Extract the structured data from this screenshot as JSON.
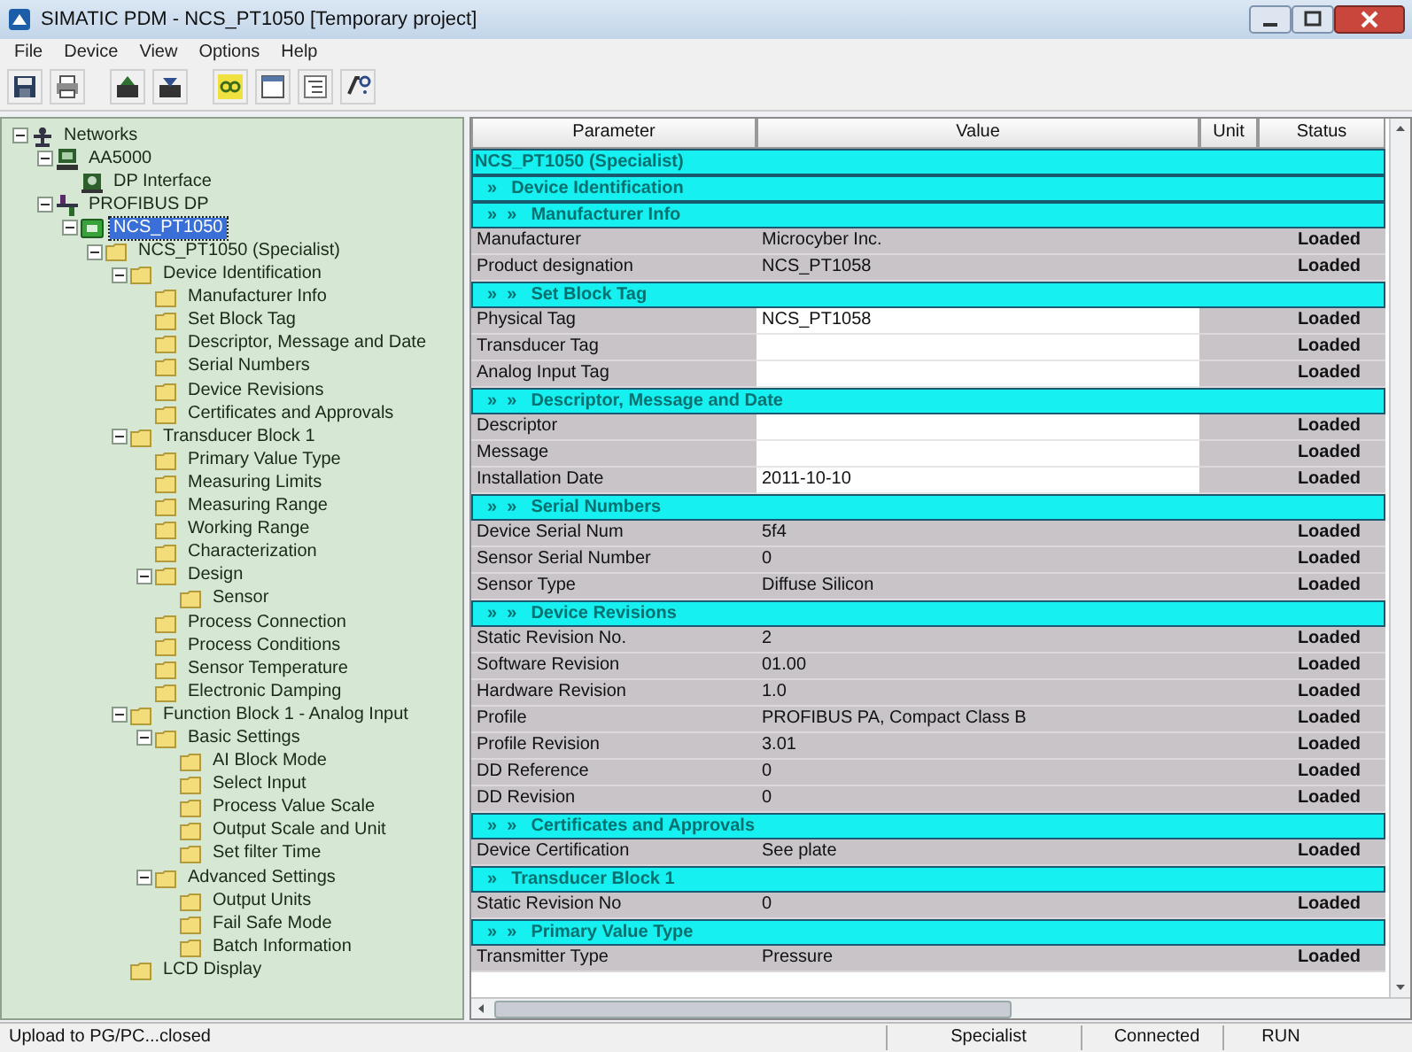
{
  "window": {
    "title": "SIMATIC PDM - NCS_PT1050 [Temporary project]"
  },
  "menu": [
    "File",
    "Device",
    "View",
    "Options",
    "Help"
  ],
  "toolbar": [
    {
      "kind": "save"
    },
    {
      "kind": "print"
    },
    {
      "kind": "upload"
    },
    {
      "kind": "download"
    },
    {
      "kind": "online"
    },
    {
      "kind": "window"
    },
    {
      "kind": "tree"
    },
    {
      "kind": "help"
    }
  ],
  "tree": [
    {
      "label": "Networks",
      "kind": "networks",
      "selected": false,
      "expanded": true,
      "children": [
        {
          "label": "AA5000",
          "kind": "computer",
          "selected": false,
          "expanded": true,
          "children": [
            {
              "label": "DP Interface",
              "kind": "interface",
              "selected": false
            }
          ]
        },
        {
          "label": "PROFIBUS DP",
          "kind": "bus",
          "selected": false,
          "expanded": true,
          "children": [
            {
              "label": "NCS_PT1050",
              "kind": "device",
              "selected": true,
              "expanded": true,
              "children": [
                {
                  "label": "NCS_PT1050 (Specialist)",
                  "kind": "folder",
                  "selected": false,
                  "expanded": true,
                  "children": [
                    {
                      "label": "Device Identification",
                      "kind": "folder",
                      "selected": false,
                      "expanded": true,
                      "children": [
                        {
                          "label": "Manufacturer Info",
                          "kind": "folder",
                          "selected": false
                        },
                        {
                          "label": "Set Block Tag",
                          "kind": "folder",
                          "selected": false
                        },
                        {
                          "label": "Descriptor, Message and Date",
                          "kind": "folder",
                          "selected": false
                        },
                        {
                          "label": "Serial Numbers",
                          "kind": "folder",
                          "selected": false
                        },
                        {
                          "label": "Device Revisions",
                          "kind": "folder",
                          "selected": false
                        },
                        {
                          "label": "Certificates and Approvals",
                          "kind": "folder",
                          "selected": false
                        }
                      ]
                    },
                    {
                      "label": "Transducer Block 1",
                      "kind": "folder",
                      "selected": false,
                      "expanded": true,
                      "children": [
                        {
                          "label": "Primary Value Type",
                          "kind": "folder",
                          "selected": false
                        },
                        {
                          "label": "Measuring Limits",
                          "kind": "folder",
                          "selected": false
                        },
                        {
                          "label": "Measuring Range",
                          "kind": "folder",
                          "selected": false
                        },
                        {
                          "label": "Working Range",
                          "kind": "folder",
                          "selected": false
                        },
                        {
                          "label": "Characterization",
                          "kind": "folder",
                          "selected": false
                        },
                        {
                          "label": "Design",
                          "kind": "folder",
                          "selected": false,
                          "expanded": true,
                          "children": [
                            {
                              "label": "Sensor",
                              "kind": "folder",
                              "selected": false
                            }
                          ]
                        },
                        {
                          "label": "Process Connection",
                          "kind": "folder",
                          "selected": false
                        },
                        {
                          "label": "Process Conditions",
                          "kind": "folder",
                          "selected": false
                        },
                        {
                          "label": "Sensor Temperature",
                          "kind": "folder",
                          "selected": false
                        },
                        {
                          "label": "Electronic Damping",
                          "kind": "folder",
                          "selected": false
                        }
                      ]
                    },
                    {
                      "label": "Function Block 1 - Analog Input",
                      "kind": "folder",
                      "selected": false,
                      "expanded": true,
                      "children": [
                        {
                          "label": "Basic Settings",
                          "kind": "folder",
                          "selected": false,
                          "expanded": true,
                          "children": [
                            {
                              "label": "AI Block Mode",
                              "kind": "folder",
                              "selected": false
                            },
                            {
                              "label": "Select Input",
                              "kind": "folder",
                              "selected": false
                            },
                            {
                              "label": "Process Value Scale",
                              "kind": "folder",
                              "selected": false
                            },
                            {
                              "label": "Output Scale and Unit",
                              "kind": "folder",
                              "selected": false
                            },
                            {
                              "label": "Set filter Time",
                              "kind": "folder",
                              "selected": false
                            }
                          ]
                        },
                        {
                          "label": "Advanced Settings",
                          "kind": "folder",
                          "selected": false,
                          "expanded": true,
                          "children": [
                            {
                              "label": "Output Units",
                              "kind": "folder",
                              "selected": false
                            },
                            {
                              "label": "Fail Safe Mode",
                              "kind": "folder",
                              "selected": false
                            },
                            {
                              "label": "Batch Information",
                              "kind": "folder",
                              "selected": false
                            }
                          ]
                        }
                      ]
                    },
                    {
                      "label": "LCD Display",
                      "kind": "folder",
                      "selected": false
                    }
                  ]
                }
              ]
            }
          ]
        }
      ]
    }
  ],
  "table": {
    "columns": [
      "Parameter",
      "Value",
      "Unit",
      "Status"
    ],
    "rows": [
      {
        "kind": "section",
        "label": "NCS_PT1050 (Specialist)"
      },
      {
        "kind": "section",
        "marker": "»",
        "label": "Device Identification"
      },
      {
        "kind": "section",
        "marker": "»  »",
        "label": "Manufacturer Info"
      },
      {
        "kind": "param",
        "parameter": "Manufacturer",
        "value": "Microcyber Inc.",
        "editable": false,
        "status": "Loaded"
      },
      {
        "kind": "param",
        "parameter": "Product designation",
        "value": "NCS_PT1058",
        "editable": false,
        "status": "Loaded"
      },
      {
        "kind": "section",
        "marker": "»  »",
        "label": "Set Block Tag"
      },
      {
        "kind": "param",
        "parameter": "Physical Tag",
        "value": "NCS_PT1058",
        "editable": true,
        "status": "Loaded"
      },
      {
        "kind": "param",
        "parameter": "Transducer Tag",
        "editable": true,
        "status": "Loaded"
      },
      {
        "kind": "param",
        "parameter": "Analog Input Tag",
        "editable": true,
        "status": "Loaded"
      },
      {
        "kind": "section",
        "marker": "»  »",
        "label": "Descriptor, Message and Date"
      },
      {
        "kind": "param",
        "parameter": "Descriptor",
        "editable": true,
        "status": "Loaded"
      },
      {
        "kind": "param",
        "parameter": "Message",
        "editable": true,
        "status": "Loaded"
      },
      {
        "kind": "param",
        "parameter": "Installation Date",
        "value": "2011-10-10",
        "editable": true,
        "status": "Loaded"
      },
      {
        "kind": "section",
        "marker": "»  »",
        "label": "Serial Numbers"
      },
      {
        "kind": "param",
        "parameter": "Device Serial Num",
        "value": "5f4",
        "editable": false,
        "status": "Loaded"
      },
      {
        "kind": "param",
        "parameter": "Sensor Serial Number",
        "value": "0",
        "editable": false,
        "status": "Loaded"
      },
      {
        "kind": "param",
        "parameter": "Sensor Type",
        "value": "Diffuse Silicon",
        "editable": false,
        "status": "Loaded"
      },
      {
        "kind": "section",
        "marker": "»  »",
        "label": "Device Revisions"
      },
      {
        "kind": "param",
        "parameter": "Static Revision No.",
        "value": "2",
        "editable": false,
        "status": "Loaded"
      },
      {
        "kind": "param",
        "parameter": "Software Revision",
        "value": "01.00",
        "editable": false,
        "status": "Loaded"
      },
      {
        "kind": "param",
        "parameter": "Hardware Revision",
        "value": "1.0",
        "editable": false,
        "status": "Loaded"
      },
      {
        "kind": "param",
        "parameter": "Profile",
        "value": "PROFIBUS PA, Compact Class B",
        "editable": false,
        "status": "Loaded"
      },
      {
        "kind": "param",
        "parameter": "Profile Revision",
        "value": "3.01",
        "editable": false,
        "status": "Loaded"
      },
      {
        "kind": "param",
        "parameter": "DD Reference",
        "value": "0",
        "editable": false,
        "status": "Loaded"
      },
      {
        "kind": "param",
        "parameter": "DD Revision",
        "value": "0",
        "editable": false,
        "status": "Loaded"
      },
      {
        "kind": "section",
        "marker": "»  »",
        "label": "Certificates and Approvals"
      },
      {
        "kind": "param",
        "parameter": "Device Certification",
        "value": "See plate",
        "editable": false,
        "status": "Loaded"
      },
      {
        "kind": "section",
        "marker": "»",
        "label": "Transducer Block 1"
      },
      {
        "kind": "param",
        "parameter": "Static Revision No",
        "value": "0",
        "editable": false,
        "status": "Loaded"
      },
      {
        "kind": "section",
        "marker": "»  »",
        "label": "Primary Value Type"
      },
      {
        "kind": "param",
        "parameter": "Transmitter Type",
        "value": "Pressure",
        "editable": false,
        "status": "Loaded"
      }
    ]
  },
  "status_bar": [
    "Upload to PG/PC...closed",
    "Specialist",
    "Connected",
    "RUN"
  ]
}
